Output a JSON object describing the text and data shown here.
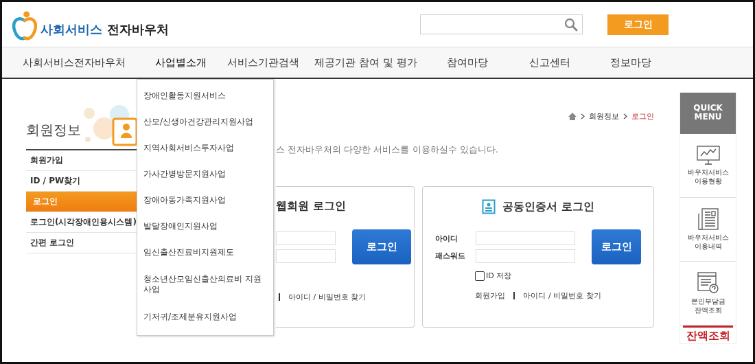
{
  "header": {
    "logo": {
      "brand": "사회서비스",
      "name": "전자바우처"
    },
    "login_button": "로그인"
  },
  "nav": [
    {
      "label": "사회서비스전자바우처",
      "expanded": false
    },
    {
      "label": "사업별소개",
      "expanded": true
    },
    {
      "label": "서비스기관검색",
      "expanded": false
    },
    {
      "label": "제공기관 참여 및 평가",
      "expanded": false
    },
    {
      "label": "참여마당",
      "expanded": false
    },
    {
      "label": "신고센터",
      "expanded": false
    },
    {
      "label": "정보마당",
      "expanded": false
    }
  ],
  "dropdown": {
    "items": [
      "장애인활동지원서비스",
      "산모/신생아건강관리지원사업",
      "지역사회서비스투자사업",
      "가사간병방문지원사업",
      "장애아동가족지원사업",
      "발달장애인지원사업",
      "임신출산진료비지원제도",
      "청소년산모임신출산의료비 지원사업",
      "기저귀/조제분유지원사업"
    ]
  },
  "sidebar": {
    "title": "회원정보",
    "items": [
      {
        "label": "회원가입",
        "selected": false
      },
      {
        "label": "ID / PW찾기",
        "selected": false
      },
      {
        "label": "로그인",
        "selected": true
      },
      {
        "label": "로그인(시각장애인용시스템)",
        "selected": false
      },
      {
        "label": "간편 로그인",
        "selected": false
      }
    ]
  },
  "breadcrumb": [
    "회원정보",
    "로그인"
  ],
  "intro": "스 전자바우처의 다양한 서비스를 이용하실수 있습니다.",
  "web_login": {
    "title": "웹회원 로그인",
    "button": "로그인",
    "links": [
      "아이디 / 비밀번호 찾기"
    ]
  },
  "cert_login": {
    "title": "공동인증서 로그인",
    "id_label": "아이디",
    "password_label": "패스워드",
    "remember": {
      "label": "ID 저장",
      "checked": false
    },
    "button": "로그인",
    "links": [
      "회원가입",
      "아이디 / 비밀번호 찾기"
    ]
  },
  "quick_menu": {
    "title": "QUICK MENU",
    "items": [
      {
        "kind": "monitor",
        "lines": [
          "바우처서비스",
          "이용현황"
        ]
      },
      {
        "kind": "document",
        "lines": [
          "바우처서비스",
          "이용내역"
        ]
      },
      {
        "kind": "search-doc",
        "lines": [
          "본인부담금",
          "잔액조회"
        ]
      }
    ],
    "balance": "잔액조회"
  }
}
